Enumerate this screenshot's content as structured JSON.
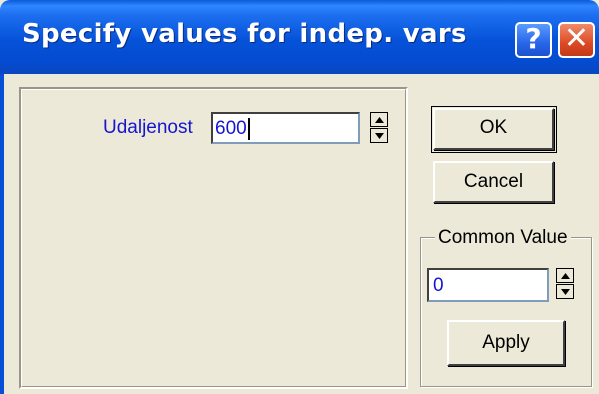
{
  "window": {
    "title": "Specify values for indep. vars",
    "help_glyph": "?",
    "close_glyph": "✕"
  },
  "variables": [
    {
      "label": "Udaljenost",
      "value": "600"
    }
  ],
  "buttons": {
    "ok": "OK",
    "cancel": "Cancel",
    "apply": "Apply"
  },
  "common_value": {
    "legend": "Common Value",
    "value": "0"
  },
  "colors": {
    "title_bar": "#0552d8",
    "dialog_bg": "#ece9d8",
    "value_text": "#1515d0",
    "close_button": "#dd4a25"
  },
  "icons": [
    "help-icon",
    "close-icon",
    "spin-up-arrow-icon",
    "spin-down-arrow-icon"
  ]
}
